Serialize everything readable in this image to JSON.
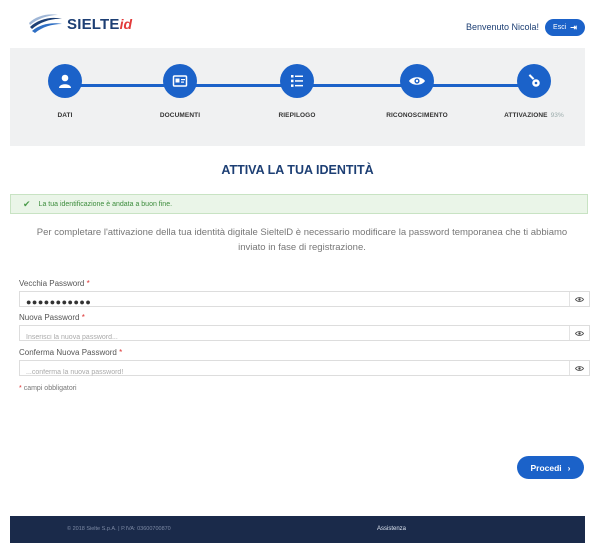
{
  "header": {
    "logo_text": "SIELTE",
    "logo_suffix": "id",
    "welcome": "Benvenuto Nicola!",
    "exit_label": "Esci"
  },
  "steps": [
    {
      "label": "DATI",
      "icon": "user-icon"
    },
    {
      "label": "DOCUMENTI",
      "icon": "id-card-icon"
    },
    {
      "label": "RIEPILOGO",
      "icon": "list-icon"
    },
    {
      "label": "RICONOSCIMENTO",
      "icon": "eye-icon"
    },
    {
      "label": "ATTIVAZIONE",
      "extra": "93%",
      "icon": "key-icon"
    }
  ],
  "page_title": "ATTIVA LA TUA IDENTITÀ",
  "alert": {
    "message": "La tua identificazione è andata a buon fine.",
    "icon": "check-icon"
  },
  "description": "Per completare l'attivazione della tua identità digitale SieltelD è necessario modificare la password temporanea che ti abbiamo inviato in fase di registrazione.",
  "form": {
    "old_password": {
      "label": "Vecchia Password",
      "required_mark": "*",
      "value": "●●●●●●●●●●●"
    },
    "new_password": {
      "label": "Nuova Password",
      "required_mark": "*",
      "placeholder": "Inserisci la nuova password..."
    },
    "confirm_password": {
      "label": "Conferma Nuova Password",
      "required_mark": "*",
      "placeholder": "...conferma la nuova password!"
    },
    "required_note_mark": "*",
    "required_note": "campi obbligatori"
  },
  "proceed_label": "Procedi",
  "footer": {
    "copyright": "© 2018 Sielte S.p.A. | P.IVA: 03600700870",
    "link": "Assistenza"
  },
  "colors": {
    "primary": "#1b62c9",
    "brand_dark": "#1d3f74",
    "brand_red": "#e23a3a",
    "success_bg": "#eaf5e8",
    "footer_bg": "#1a2a4a"
  }
}
